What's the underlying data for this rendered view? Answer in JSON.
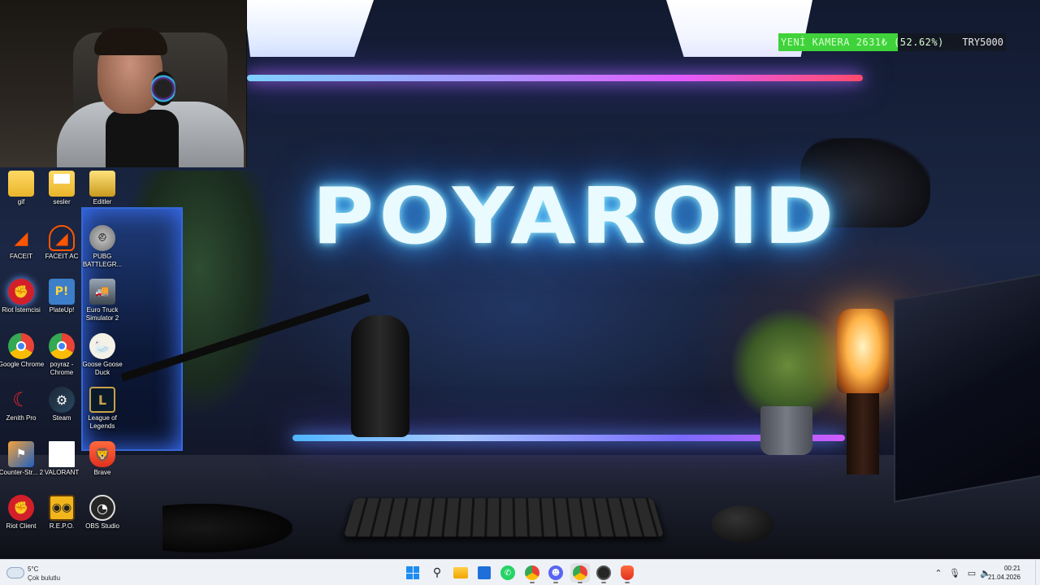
{
  "wallpaper": {
    "brand_title": "POYAROID"
  },
  "stream": {
    "ticker_label": "YENİ KAMERA  2631₺ (52.62%)",
    "ticker_goal": "TRY5000",
    "progress_percent": 52.62,
    "bar_color": "#3fd23a"
  },
  "desktop_icons": [
    {
      "label": "gif",
      "icon": "folder-icon"
    },
    {
      "label": "sesler",
      "icon": "folder-icon"
    },
    {
      "label": "Editler",
      "icon": "folder-icon"
    },
    {
      "label": "FACEIT",
      "icon": "faceit-icon"
    },
    {
      "label": "FACEIT AC",
      "icon": "faceit-ac-icon"
    },
    {
      "label": "PUBG BATTLEGR...",
      "icon": "pubg-icon"
    },
    {
      "label": "Riot İstemcisi",
      "icon": "riot-icon"
    },
    {
      "label": "PlateUp!",
      "icon": "plateup-icon"
    },
    {
      "label": "Euro Truck Simulator 2",
      "icon": "truck-icon"
    },
    {
      "label": "Google Chrome",
      "icon": "chrome-icon"
    },
    {
      "label": "poyraz - Chrome",
      "icon": "chrome-icon"
    },
    {
      "label": "Goose Goose Duck",
      "icon": "goose-icon"
    },
    {
      "label": "Zenith Pro",
      "icon": "zenith-icon"
    },
    {
      "label": "Steam",
      "icon": "steam-icon"
    },
    {
      "label": "League of Legends",
      "icon": "league-icon"
    },
    {
      "label": "Counter-Str... 2",
      "icon": "cs2-icon"
    },
    {
      "label": "VALORANT",
      "icon": "valorant-icon"
    },
    {
      "label": "Brave",
      "icon": "brave-icon"
    },
    {
      "label": "Riot Client",
      "icon": "riot-icon"
    },
    {
      "label": "R.E.P.O.",
      "icon": "repo-icon"
    },
    {
      "label": "OBS Studio",
      "icon": "obs-icon"
    }
  ],
  "taskbar": {
    "weather_temp": "5°C",
    "weather_condition": "Çok bulutlu",
    "apps": [
      "start-icon",
      "search-icon",
      "file-explorer-icon",
      "store-icon",
      "whatsapp-icon",
      "chrome-profile-icon",
      "discord-icon",
      "chrome-icon",
      "obs-icon",
      "brave-icon"
    ],
    "tray_icons": [
      "chevron-up-icon",
      "microphone-icon",
      "display-icon",
      "speaker-icon"
    ],
    "clock_time": "00:21",
    "clock_date": "21.04.2026"
  },
  "colors": {
    "taskbar_bg": "#eef1f6",
    "accent": "#1e8cf2",
    "neon_top": "#e35cff",
    "neon_bottom": "#5c8dff"
  }
}
